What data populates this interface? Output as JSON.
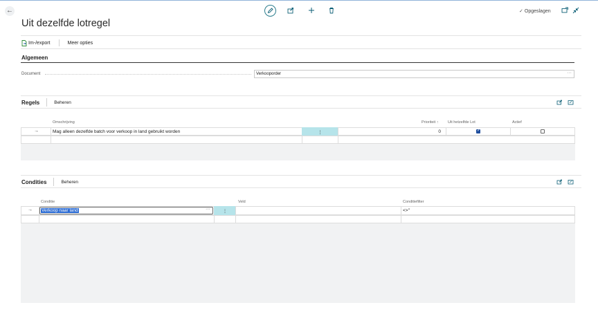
{
  "page": {
    "title": "Uit dezelfde lotregel",
    "status": "Opgeslagen"
  },
  "toolbar": {
    "import_export_label": "Im-/export",
    "more_options_label": "Meer opties"
  },
  "general": {
    "section_title": "Algemeen",
    "document_label": "Document",
    "document_value": "Verkooporder",
    "more_glyph": "···"
  },
  "rules": {
    "section_title": "Regels",
    "manage_label": "Beheren",
    "columns": {
      "description": "Omschrijving",
      "priority": "Prioriteit ↑",
      "same_lot": "Uit hetzelfde Lot",
      "active": "Actief"
    },
    "rows": [
      {
        "description": "Mag alleen dezelfde batch voor verkoop in land gebruikt worden",
        "priority": "0",
        "same_lot": true,
        "active": false
      }
    ],
    "row_arrow": "→",
    "actions_glyph": "⋮"
  },
  "conditions": {
    "section_title": "Condities",
    "manage_label": "Beheren",
    "columns": {
      "condition": "Conditie",
      "field": "Veld",
      "filter": "Conditiefilter"
    },
    "rows": [
      {
        "condition": "Verkoop naar land",
        "field": "",
        "filter": "<>''"
      }
    ],
    "row_arrow": "→",
    "actions_glyph": "⋮",
    "more_glyph": "···"
  },
  "icons": {
    "back": "arrow-left-icon",
    "edit": "pencil-icon",
    "share": "share-icon",
    "new": "plus-icon",
    "delete": "trash-icon",
    "open_new_window": "open-in-new-window-icon",
    "collapse": "collapse-icon"
  }
}
